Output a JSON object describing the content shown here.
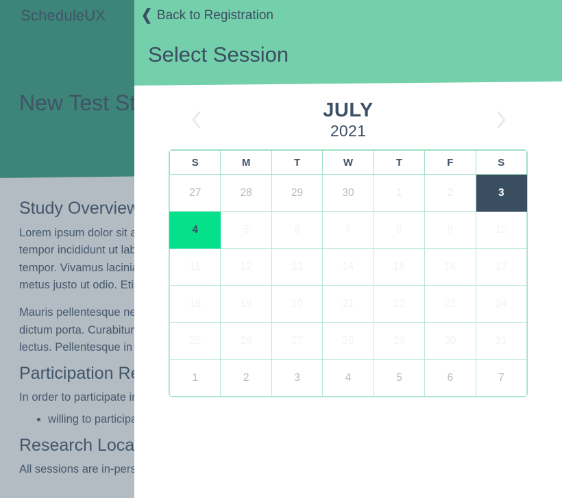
{
  "background": {
    "logo": "ScheduleUX",
    "hero_title": "New Test Study",
    "sections": [
      {
        "heading": "Study Overview",
        "paragraphs": [
          "Lorem ipsum dolor sit amet, consectetur adipiscing elit, sed do eiusmod tempor incididunt ut labore et dolore magna aliqua. Vivamus volutpat tempor. Vivamus lacinia odio vitae vestibulum vestibulum cras porttitor metus justo ut odio. Etiam pretium iaculis justo.",
          "Mauris pellentesque nec, egestas non nisi. Cras ultricies ligula sed magna dictum porta. Curabitur non nulla sit amet nisl tempus convallis quis ac lectus. Pellentesque in ipsum id orci porta dapibus."
        ]
      },
      {
        "heading": "Participation Requirements",
        "paragraphs": [
          "In order to participate in this research study, you must be:"
        ],
        "bullets": [
          "willing to participate in an in-person session"
        ]
      },
      {
        "heading": "Research Location",
        "paragraphs": [
          "All sessions are in-person at our downtown research facility."
        ]
      }
    ]
  },
  "modal": {
    "back_label": "Back to Registration",
    "back_icon": "chevron-left-icon",
    "title": "Select Session"
  },
  "calendar": {
    "month": "JULY",
    "year": "2021",
    "prev_icon": "chevron-left-icon",
    "next_icon": "chevron-right-icon",
    "weekday_headers": [
      "S",
      "M",
      "T",
      "W",
      "T",
      "F",
      "S"
    ],
    "selected_date": "3",
    "today_date": "4",
    "weeks": [
      [
        {
          "day": "27",
          "state": "adjacent"
        },
        {
          "day": "28",
          "state": "adjacent"
        },
        {
          "day": "29",
          "state": "adjacent"
        },
        {
          "day": "30",
          "state": "adjacent"
        },
        {
          "day": "1",
          "state": "faded"
        },
        {
          "day": "2",
          "state": "faded"
        },
        {
          "day": "3",
          "state": "selected"
        }
      ],
      [
        {
          "day": "4",
          "state": "today"
        },
        {
          "day": "5",
          "state": "veryfaded"
        },
        {
          "day": "6",
          "state": "veryfaded"
        },
        {
          "day": "7",
          "state": "veryfaded"
        },
        {
          "day": "8",
          "state": "veryfaded"
        },
        {
          "day": "9",
          "state": "veryfaded"
        },
        {
          "day": "10",
          "state": "veryfaded"
        }
      ],
      [
        {
          "day": "11",
          "state": "veryfaded"
        },
        {
          "day": "12",
          "state": "veryfaded"
        },
        {
          "day": "13",
          "state": "veryfaded"
        },
        {
          "day": "14",
          "state": "veryfaded"
        },
        {
          "day": "15",
          "state": "veryfaded"
        },
        {
          "day": "16",
          "state": "veryfaded"
        },
        {
          "day": "17",
          "state": "veryfaded"
        }
      ],
      [
        {
          "day": "18",
          "state": "veryfaded"
        },
        {
          "day": "19",
          "state": "veryfaded"
        },
        {
          "day": "20",
          "state": "veryfaded"
        },
        {
          "day": "21",
          "state": "veryfaded"
        },
        {
          "day": "22",
          "state": "veryfaded"
        },
        {
          "day": "23",
          "state": "veryfaded"
        },
        {
          "day": "24",
          "state": "veryfaded"
        }
      ],
      [
        {
          "day": "25",
          "state": "veryfaded"
        },
        {
          "day": "26",
          "state": "veryfaded"
        },
        {
          "day": "27",
          "state": "veryfaded"
        },
        {
          "day": "28",
          "state": "veryfaded"
        },
        {
          "day": "29",
          "state": "veryfaded"
        },
        {
          "day": "30",
          "state": "veryfaded"
        },
        {
          "day": "31",
          "state": "veryfaded"
        }
      ],
      [
        {
          "day": "1",
          "state": "adjacent"
        },
        {
          "day": "2",
          "state": "adjacent"
        },
        {
          "day": "3",
          "state": "adjacent"
        },
        {
          "day": "4",
          "state": "adjacent"
        },
        {
          "day": "5",
          "state": "adjacent"
        },
        {
          "day": "6",
          "state": "adjacent"
        },
        {
          "day": "7",
          "state": "adjacent"
        }
      ]
    ]
  },
  "colors": {
    "hero_green": "#34a27f",
    "modal_header_green": "#74cfab",
    "accent_green": "#05e08a",
    "selected_navy": "#3a4e62",
    "text_navy": "#3d5166",
    "grid_green": "#b6e8d2"
  }
}
